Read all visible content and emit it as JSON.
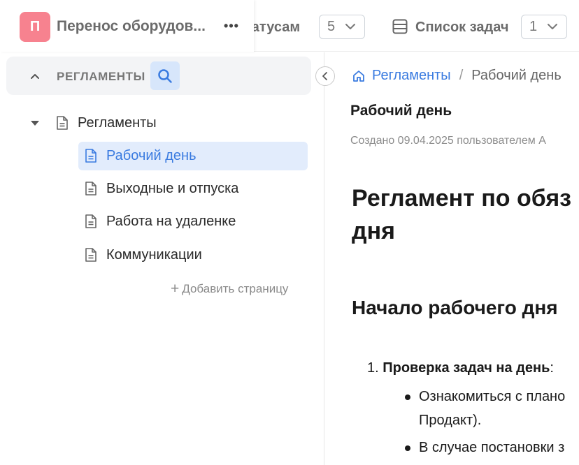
{
  "project": {
    "avatar_letter": "П",
    "name": "Перенос оборудов...",
    "more_glyph": "•••"
  },
  "toolbar": {
    "status_label": "татусам",
    "status_count": "5",
    "tasks_label": "Список задач",
    "tasks_count": "1"
  },
  "sidebar": {
    "title": "РЕГЛАМЕНТЫ",
    "root_label": "Регламенты",
    "items": [
      {
        "label": "Рабочий день",
        "active": true
      },
      {
        "label": "Выходные и отпуска",
        "active": false
      },
      {
        "label": "Работа на удаленке",
        "active": false
      },
      {
        "label": "Коммуникации",
        "active": false
      }
    ],
    "add_page_label": "Добавить страницу"
  },
  "content": {
    "breadcrumb": {
      "link": "Регламенты",
      "separator": "/",
      "current": "Рабочий день"
    },
    "title": "Рабочий день",
    "meta": "Создано 09.04.2025 пользователем А",
    "heading1": "Регламент по обяз дня",
    "heading1_line1": "Регламент по обяз",
    "heading1_line2": "дня",
    "heading2": "Начало рабочего дня",
    "list_number": "1.",
    "list_item_bold": "Проверка задач на день",
    "list_item_suffix": ":",
    "bullets": [
      {
        "line1": "Ознакомиться с плано",
        "line2": "Продакт)."
      },
      {
        "line1": "В случае постановки з",
        "line2": ""
      }
    ]
  },
  "colors": {
    "accent": "#3a7be0",
    "avatar": "#f7828f",
    "active_item_bg": "#e2ecfc",
    "search_bg": "#d7e6fb"
  }
}
